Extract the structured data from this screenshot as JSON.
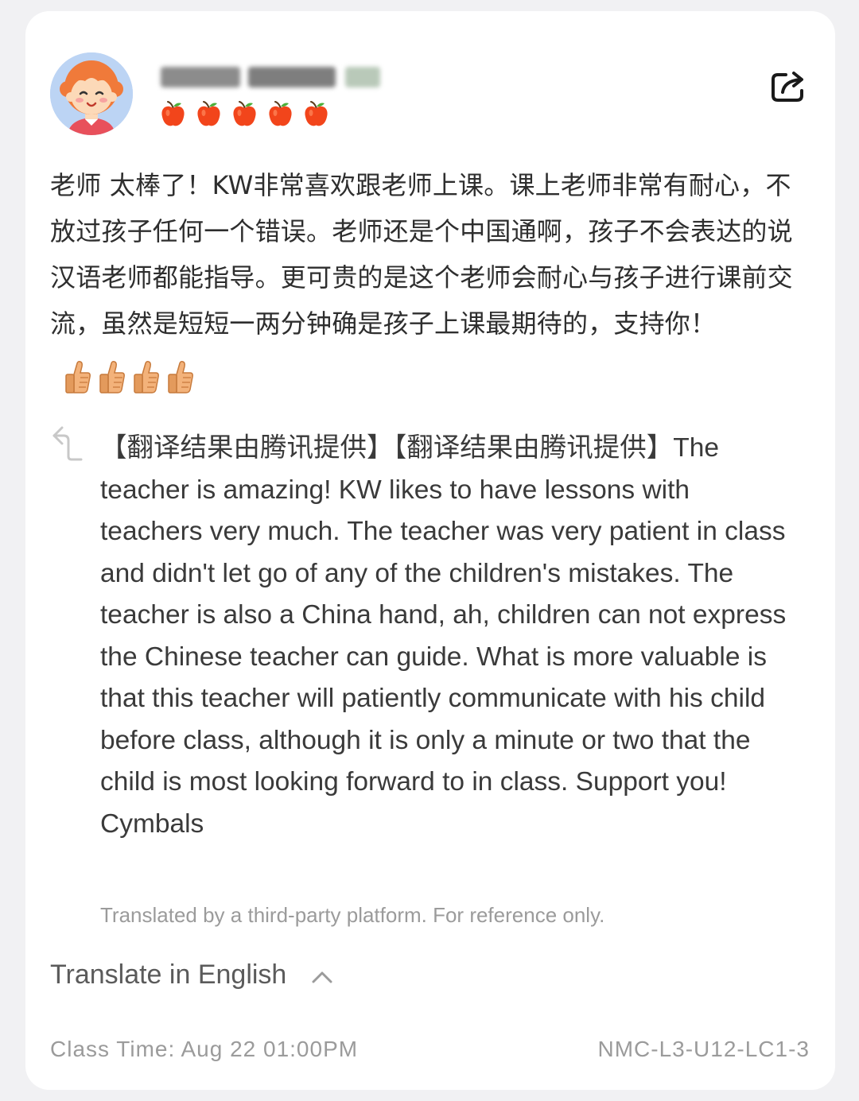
{
  "reviewer": {
    "avatar_icon": "cartoon-child-avatar",
    "name_obscured": true,
    "rating": 5,
    "rating_icon": "apple-icon"
  },
  "actions": {
    "share_icon": "share-icon"
  },
  "review": {
    "text": "老师 太棒了！KW非常喜欢跟老师上课。课上老师非常有耐心，不放过孩子任何一个错误。老师还是个中国通啊，孩子不会表达的说汉语老师都能指导。更可贵的是这个老师会耐心与孩子进行课前交流，虽然是短短一两分钟确是孩子上课最期待的，支持你！",
    "emoji_icon": "thumbs-up-icon",
    "emoji_count": 4
  },
  "translation": {
    "icon": "reply-arrow-icon",
    "text": "【翻译结果由腾讯提供】【翻译结果由腾讯提供】The teacher is amazing! KW likes to have lessons with teachers very much. The teacher was very patient in class and didn't let go of any of the children's mistakes. The teacher is also a China hand, ah, children can not express the Chinese teacher can guide. What is more valuable is that this teacher will patiently communicate with his child before class, although it is only a minute or two that the child is most looking forward to in class. Support you! Cymbals",
    "disclaimer": "Translated by a third-party platform. For reference only."
  },
  "translate_toggle": {
    "label": "Translate in English",
    "icon": "chevron-up-icon"
  },
  "footer": {
    "class_time": "Class Time: Aug 22 01:00PM",
    "course_code": "NMC-L3-U12-LC1-3"
  },
  "colors": {
    "background": "#f1f1f3",
    "card": "#ffffff",
    "apple": "#f2451b",
    "text_primary": "#2e2e2e",
    "text_muted": "#9b9b9b"
  }
}
